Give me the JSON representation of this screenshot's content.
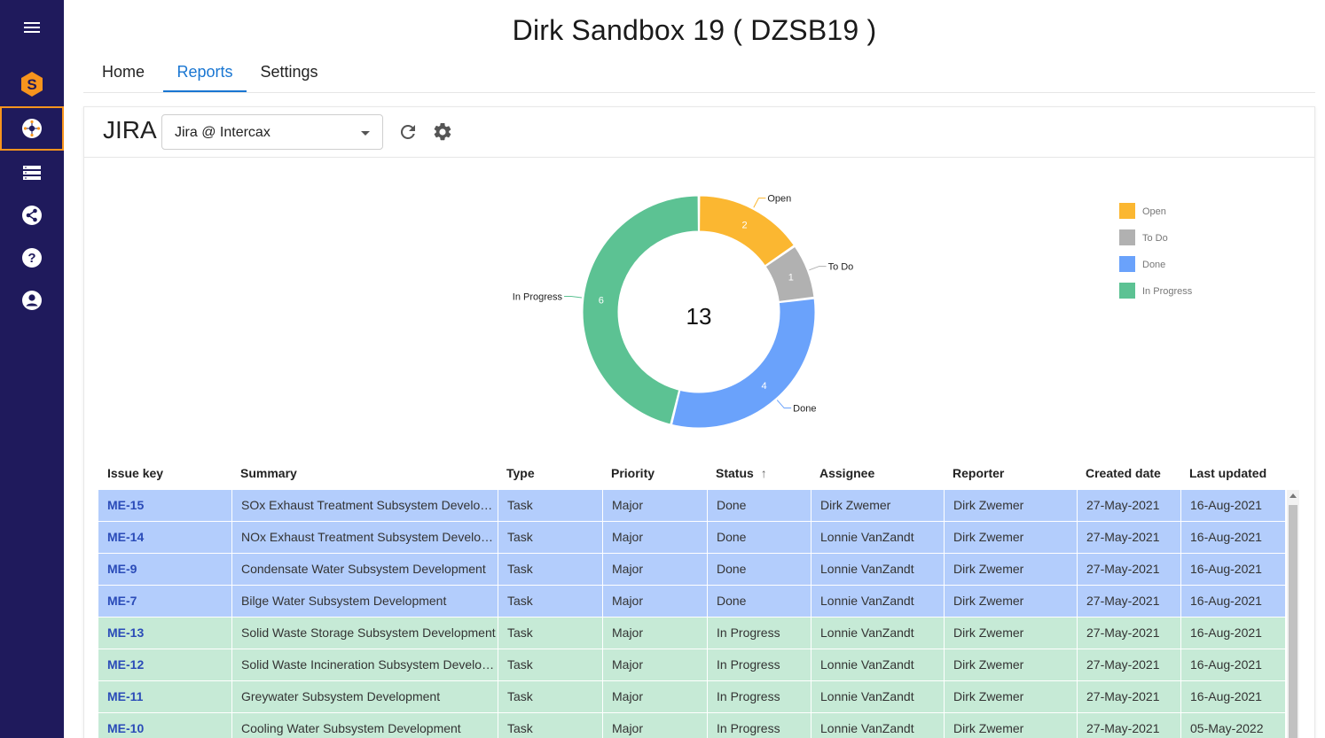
{
  "app": {
    "title": "Dirk Sandbox 19 ( DZSB19 )"
  },
  "tabs": [
    {
      "label": "Home",
      "active": false
    },
    {
      "label": "Reports",
      "active": true
    },
    {
      "label": "Settings",
      "active": false
    }
  ],
  "sidebar": {
    "items": [
      {
        "name": "menu",
        "icon": "hamburger-icon"
      },
      {
        "name": "logo",
        "icon": "syndeia-logo-icon"
      },
      {
        "name": "jira",
        "icon": "integration-hub-icon",
        "active": true
      },
      {
        "name": "repositories",
        "icon": "list-icon"
      },
      {
        "name": "share",
        "icon": "share-icon"
      },
      {
        "name": "help",
        "icon": "help-icon"
      },
      {
        "name": "account",
        "icon": "account-icon"
      }
    ]
  },
  "panel": {
    "label": "JIRA",
    "select": {
      "value": "Jira @ Intercax"
    },
    "refresh_icon": "refresh-icon",
    "settings_icon": "gear-icon"
  },
  "chart_data": {
    "type": "pie",
    "style": "donut",
    "total": "13",
    "slices": [
      {
        "label": "Open",
        "value": 2,
        "color": "#fbb731"
      },
      {
        "label": "To Do",
        "value": 1,
        "color": "#b1b1b1"
      },
      {
        "label": "Done",
        "value": 4,
        "color": "#6aa2fb"
      },
      {
        "label": "In Progress",
        "value": 6,
        "color": "#5cc293"
      }
    ],
    "legend": [
      "Open",
      "To Do",
      "Done",
      "In Progress"
    ],
    "legend_position": "right"
  },
  "table": {
    "columns": [
      "Issue key",
      "Summary",
      "Type",
      "Priority",
      "Status",
      "Assignee",
      "Reporter",
      "Created date",
      "Last updated"
    ],
    "sort_indicator": "↑",
    "rows": [
      {
        "key": "ME-15",
        "summary": "SOx Exhaust Treatment Subsystem Development",
        "type": "Task",
        "priority": "Major",
        "status": "Done",
        "assignee": "Dirk Zwemer",
        "reporter": "Dirk Zwemer",
        "created": "27-May-2021",
        "updated": "16-Aug-2021"
      },
      {
        "key": "ME-14",
        "summary": "NOx Exhaust Treatment Subsystem Development",
        "type": "Task",
        "priority": "Major",
        "status": "Done",
        "assignee": "Lonnie VanZandt",
        "reporter": "Dirk Zwemer",
        "created": "27-May-2021",
        "updated": "16-Aug-2021"
      },
      {
        "key": "ME-9",
        "summary": "Condensate Water Subsystem Development",
        "type": "Task",
        "priority": "Major",
        "status": "Done",
        "assignee": "Lonnie VanZandt",
        "reporter": "Dirk Zwemer",
        "created": "27-May-2021",
        "updated": "16-Aug-2021"
      },
      {
        "key": "ME-7",
        "summary": "Bilge Water Subsystem Development",
        "type": "Task",
        "priority": "Major",
        "status": "Done",
        "assignee": "Lonnie VanZandt",
        "reporter": "Dirk Zwemer",
        "created": "27-May-2021",
        "updated": "16-Aug-2021"
      },
      {
        "key": "ME-13",
        "summary": "Solid Waste Storage Subsystem Development",
        "type": "Task",
        "priority": "Major",
        "status": "In Progress",
        "assignee": "Lonnie VanZandt",
        "reporter": "Dirk Zwemer",
        "created": "27-May-2021",
        "updated": "16-Aug-2021"
      },
      {
        "key": "ME-12",
        "summary": "Solid Waste Incineration Subsystem Development",
        "type": "Task",
        "priority": "Major",
        "status": "In Progress",
        "assignee": "Lonnie VanZandt",
        "reporter": "Dirk Zwemer",
        "created": "27-May-2021",
        "updated": "16-Aug-2021"
      },
      {
        "key": "ME-11",
        "summary": "Greywater Subsystem Development",
        "type": "Task",
        "priority": "Major",
        "status": "In Progress",
        "assignee": "Lonnie VanZandt",
        "reporter": "Dirk Zwemer",
        "created": "27-May-2021",
        "updated": "16-Aug-2021"
      },
      {
        "key": "ME-10",
        "summary": "Cooling Water Subsystem Development",
        "type": "Task",
        "priority": "Major",
        "status": "In Progress",
        "assignee": "Lonnie VanZandt",
        "reporter": "Dirk Zwemer",
        "created": "27-May-2021",
        "updated": "05-May-2022"
      }
    ]
  }
}
